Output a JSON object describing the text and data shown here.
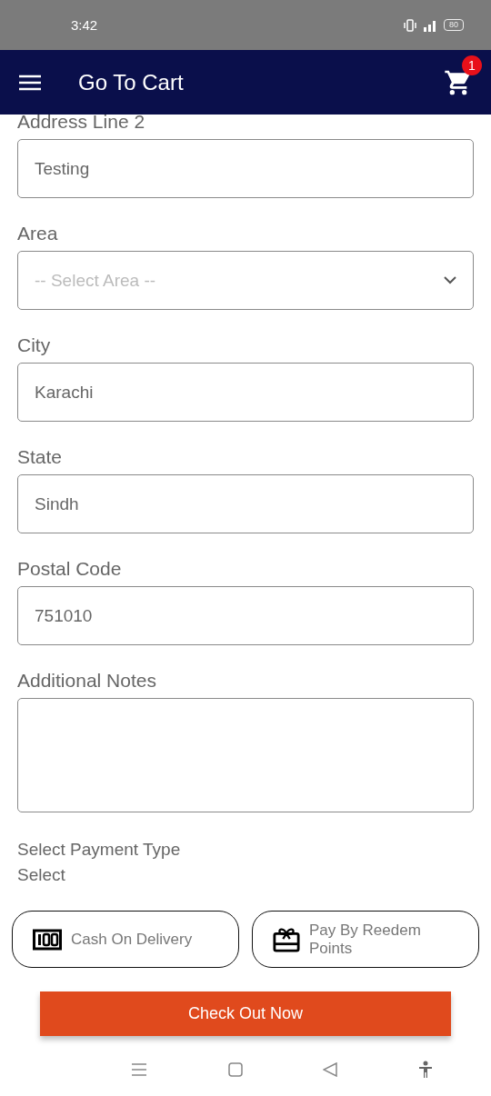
{
  "status_bar": {
    "time": "3:42",
    "battery": "80"
  },
  "app_bar": {
    "title": "Go To Cart",
    "cart_count": "1"
  },
  "form": {
    "fields": [
      {
        "kind": "text",
        "label": "Address Line 2",
        "value": "Testing"
      },
      {
        "kind": "select",
        "label": "Area",
        "placeholder": "-- Select Area --"
      },
      {
        "kind": "text",
        "label": "City",
        "value": "Karachi"
      },
      {
        "kind": "text",
        "label": "State",
        "value": "Sindh"
      },
      {
        "kind": "text",
        "label": "Postal Code",
        "value": "751010"
      },
      {
        "kind": "textarea",
        "label": "Additional Notes"
      }
    ]
  },
  "payment": {
    "title": "Select Payment Type",
    "subtitle": "Select",
    "options": [
      {
        "kind": "cash",
        "label": "Cash On Delivery",
        "selected": false
      },
      {
        "kind": "points",
        "label": "Pay By Reedem Points",
        "selected": false
      }
    ]
  },
  "checkout_button": "Check Out Now"
}
